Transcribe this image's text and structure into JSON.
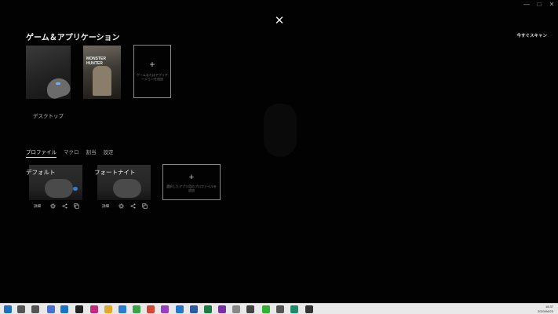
{
  "window": {
    "minimize": "—",
    "maximize": "□",
    "close": "✕",
    "overlay_close": "✕"
  },
  "games": {
    "title": "ゲーム＆アプリケーション",
    "scan_now": "今すぐスキャン",
    "items": [
      {
        "caption": "デスクトップ"
      },
      {
        "caption": "",
        "art_text": "MONSTER HUNTER"
      }
    ],
    "add": {
      "plus": "+",
      "label": "ゲームまたはアプリケーションを追加"
    }
  },
  "tabs": [
    {
      "label": "プロファイル",
      "active": true
    },
    {
      "label": "マクロ",
      "active": false
    },
    {
      "label": "割当",
      "active": false
    },
    {
      "label": "設定",
      "active": false
    }
  ],
  "profiles": [
    {
      "name": "デフォルト",
      "detail": "詳細"
    },
    {
      "name": "フォートナイト",
      "detail": "詳細"
    }
  ],
  "profile_actions": {
    "set_active_icon": "gear-icon",
    "share_icon": "share-icon",
    "copy_icon": "copy-icon"
  },
  "add_profile": {
    "plus": "+",
    "label": "選択したアプリ用のプロファイルを追加"
  },
  "taskbar": {
    "time": "18:37",
    "date": "2020/06/23",
    "apps": [
      {
        "icon": "windows-start-icon",
        "color": "#1f6fc5"
      },
      {
        "icon": "search-icon",
        "color": "#555555"
      },
      {
        "icon": "task-view-icon",
        "color": "#555555"
      },
      {
        "icon": "logitech-ghub-icon",
        "color": "#4a6ed6"
      },
      {
        "icon": "app-icon-1",
        "color": "#1a73c8"
      },
      {
        "icon": "app-icon-2",
        "color": "#222222"
      },
      {
        "icon": "app-icon-3",
        "color": "#c42b7a"
      },
      {
        "icon": "file-explorer-icon",
        "color": "#e0a82e"
      },
      {
        "icon": "mail-icon",
        "color": "#2a7ad6"
      },
      {
        "icon": "chrome-icon",
        "color": "#3aa34a"
      },
      {
        "icon": "chrome-icon",
        "color": "#d64535"
      },
      {
        "icon": "app-icon-4",
        "color": "#9a3fc4"
      },
      {
        "icon": "edge-icon",
        "color": "#2277cc"
      },
      {
        "icon": "word-icon",
        "color": "#2b5aa8"
      },
      {
        "icon": "excel-icon",
        "color": "#1f7a44"
      },
      {
        "icon": "onenote-icon",
        "color": "#7a2fa8"
      },
      {
        "icon": "app-icon-5",
        "color": "#888888"
      },
      {
        "icon": "app-icon-6",
        "color": "#444444"
      },
      {
        "icon": "line-icon",
        "color": "#33b033"
      },
      {
        "icon": "app-icon-7",
        "color": "#555555"
      },
      {
        "icon": "app-icon-8",
        "color": "#1e8a6a"
      },
      {
        "icon": "app-icon-9",
        "color": "#333333"
      }
    ]
  }
}
